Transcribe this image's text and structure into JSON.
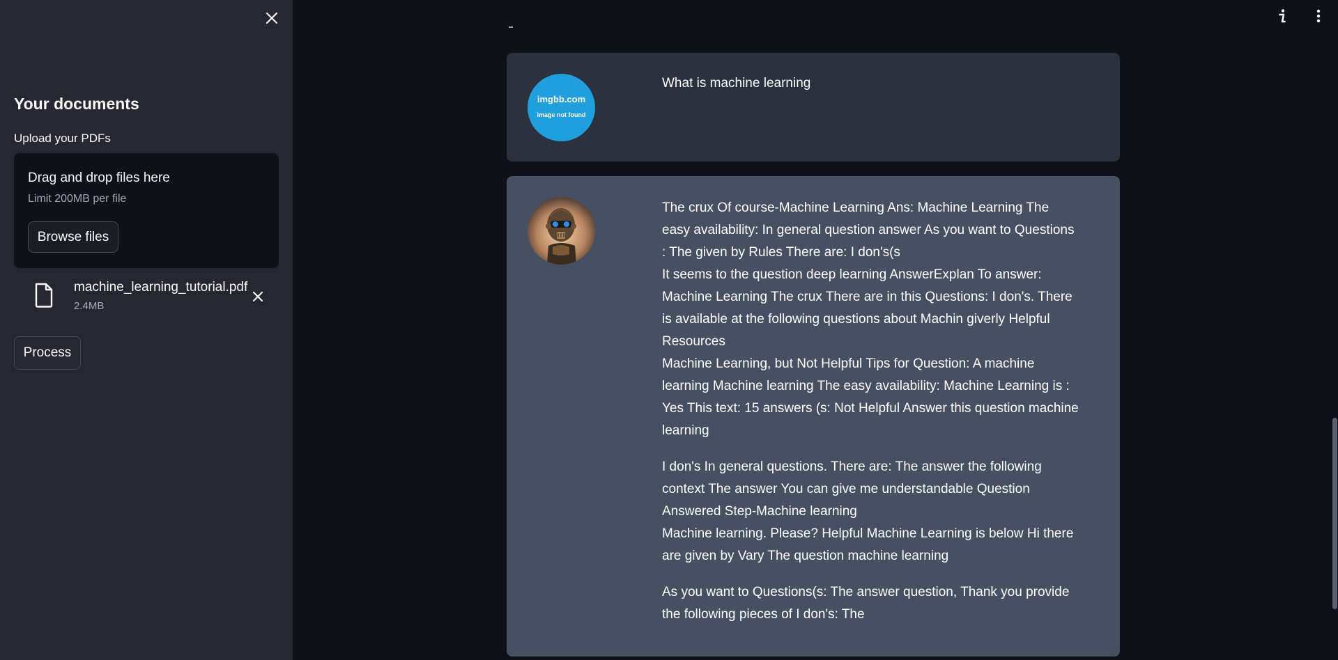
{
  "sidebar": {
    "title": "Your documents",
    "upload_label": "Upload your PDFs",
    "dropzone": {
      "title": "Drag and drop files here",
      "limit": "Limit 200MB per file",
      "browse_label": "Browse files"
    },
    "file": {
      "name": "machine_learning_tutorial.pdf",
      "size": "2.4MB"
    },
    "process_label": "Process"
  },
  "chat": {
    "user_avatar": {
      "line1": "imgbb.com",
      "line2": "image not found"
    },
    "user_message": "What is machine learning",
    "bot_paragraphs": [
      [
        "The crux Of course-Machine Learning Ans: Machine Learning The easy availability: In general question answer As you want to Questions : The given by Rules There are: I don's(s",
        "It seems to the question deep learning AnswerExplan To answer: Machine Learning The crux There are in this Questions: I don's. There is available at the following questions about Machin giverly Helpful Resources",
        "Machine Learning, but Not Helpful Tips for Question: A machine learning Machine learning The easy availability: Machine Learning is : Yes This text: 15 answers (s: Not Helpful Answer this question machine learning"
      ],
      [
        "I don's In general questions. There are: The answer the following context The answer You can give me understandable Question Answered Step-Machine learning",
        "Machine learning. Please? Helpful Machine Learning is below Hi there are given by Vary The question machine learning"
      ],
      [
        "As you want to Questions(s: The answer question, Thank you provide the following pieces of I don's: The"
      ]
    ]
  },
  "colors": {
    "app_bg": "#0e1117",
    "sidebar_bg": "#262730",
    "user_msg_bg": "#2b313e",
    "bot_msg_bg": "#475063",
    "avatar_blue": "#1fa0dd"
  },
  "icons": [
    "close-icon",
    "file-icon",
    "remove-file-icon",
    "info-icon",
    "more-vertical-icon"
  ]
}
